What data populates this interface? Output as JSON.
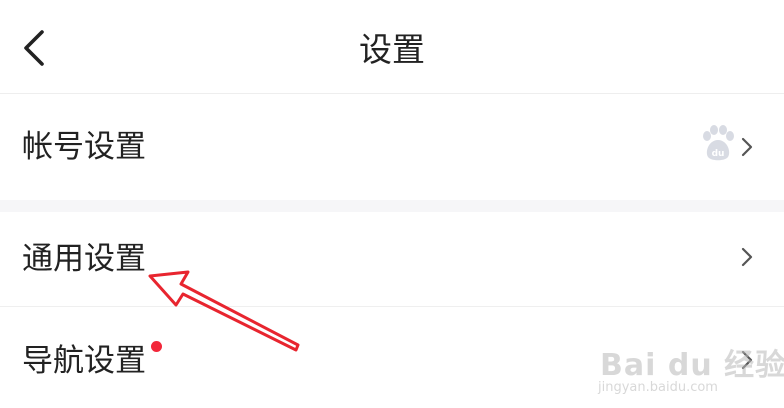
{
  "header": {
    "title": "设置",
    "back_icon": "chevron-left-icon"
  },
  "settings": {
    "items": [
      {
        "label": "帐号设置",
        "trailing_icon": "baidu-paw-icon",
        "chevron": "chevron-right-icon",
        "has_red_dot": false
      },
      {
        "label": "通用设置",
        "chevron": "chevron-right-icon",
        "has_red_dot": false
      },
      {
        "label": "导航设置",
        "chevron": "chevron-right-icon",
        "has_red_dot": true
      }
    ]
  },
  "watermark": {
    "brand": "Bai du 经验",
    "sub": "jingyan.baidu.com"
  },
  "colors": {
    "text": "#222222",
    "divider": "#eeeeee",
    "gap": "#f6f6f8",
    "red_dot": "#f2273a",
    "annotation_arrow": "#e8252f",
    "chevron": "#555555"
  }
}
